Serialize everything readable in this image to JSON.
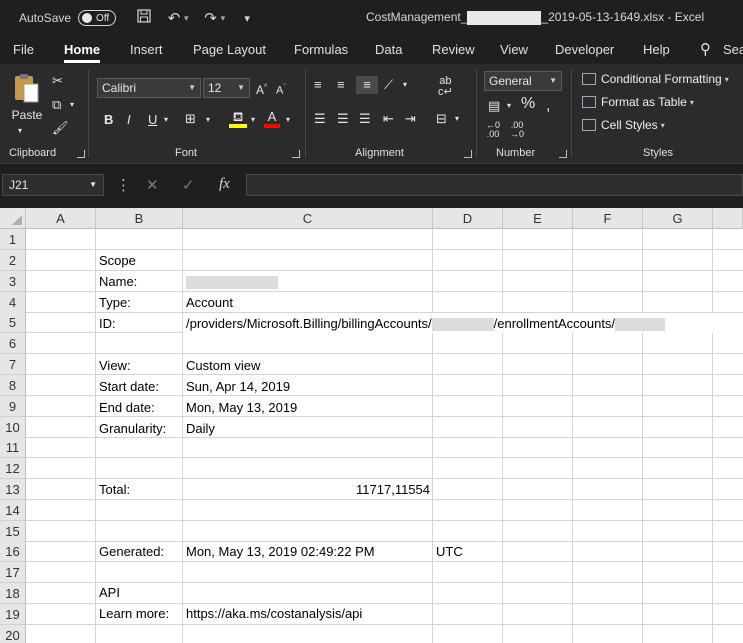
{
  "titlebar": {
    "autosave_label": "AutoSave",
    "autosave_state": "Off",
    "doc_title_prefix": "CostManagement_",
    "doc_title_suffix": "_2019-05-13-1649.xlsx  -  Excel"
  },
  "tabs": [
    "File",
    "Home",
    "Insert",
    "Page Layout",
    "Formulas",
    "Data",
    "Review",
    "View",
    "Developer",
    "Help",
    "Sea"
  ],
  "active_tab": "Home",
  "ribbon": {
    "clipboard": {
      "label": "Clipboard",
      "paste_label": "Paste"
    },
    "font": {
      "label": "Font",
      "font_name": "Calibri",
      "font_size": "12",
      "bold": "B",
      "italic": "I",
      "underline": "U"
    },
    "alignment": {
      "label": "Alignment"
    },
    "number": {
      "label": "Number",
      "format": "General"
    },
    "styles": {
      "label": "Styles",
      "conditional_formatting": "Conditional Formatting",
      "format_as_table": "Format as Table",
      "cell_styles": "Cell Styles"
    },
    "colors": {
      "highlight": "#ffff00",
      "font_color": "#ff0000"
    }
  },
  "formula_bar": {
    "name_box": "J21",
    "fx": "fx",
    "content": ""
  },
  "columns": [
    "A",
    "B",
    "C",
    "D",
    "E",
    "F",
    "G"
  ],
  "rows": [
    "1",
    "2",
    "3",
    "4",
    "5",
    "6",
    "7",
    "8",
    "9",
    "10",
    "11",
    "12",
    "13",
    "14",
    "15",
    "16",
    "17",
    "18",
    "19",
    "20"
  ],
  "cells": {
    "B2": "Scope",
    "B3": "Name:",
    "B4": "Type:",
    "C4": "Account",
    "B5": "ID:",
    "C5_a": "/providers/Microsoft.Billing/billingAccounts/",
    "C5_b": "/enrollmentAccounts/",
    "B7": "View:",
    "C7": "Custom view",
    "B8": "Start date:",
    "C8": "Sun, Apr 14, 2019",
    "B9": "End date:",
    "C9": "Mon, May 13, 2019",
    "B10": "Granularity:",
    "C10": "Daily",
    "B13": "Total:",
    "C13": "11717,11554",
    "B16": "Generated:",
    "C16": "Mon, May 13, 2019 02:49:22 PM",
    "D16": "UTC",
    "B18": "API",
    "B19": "Learn more:",
    "C19": "https://aka.ms/costanalysis/api"
  }
}
